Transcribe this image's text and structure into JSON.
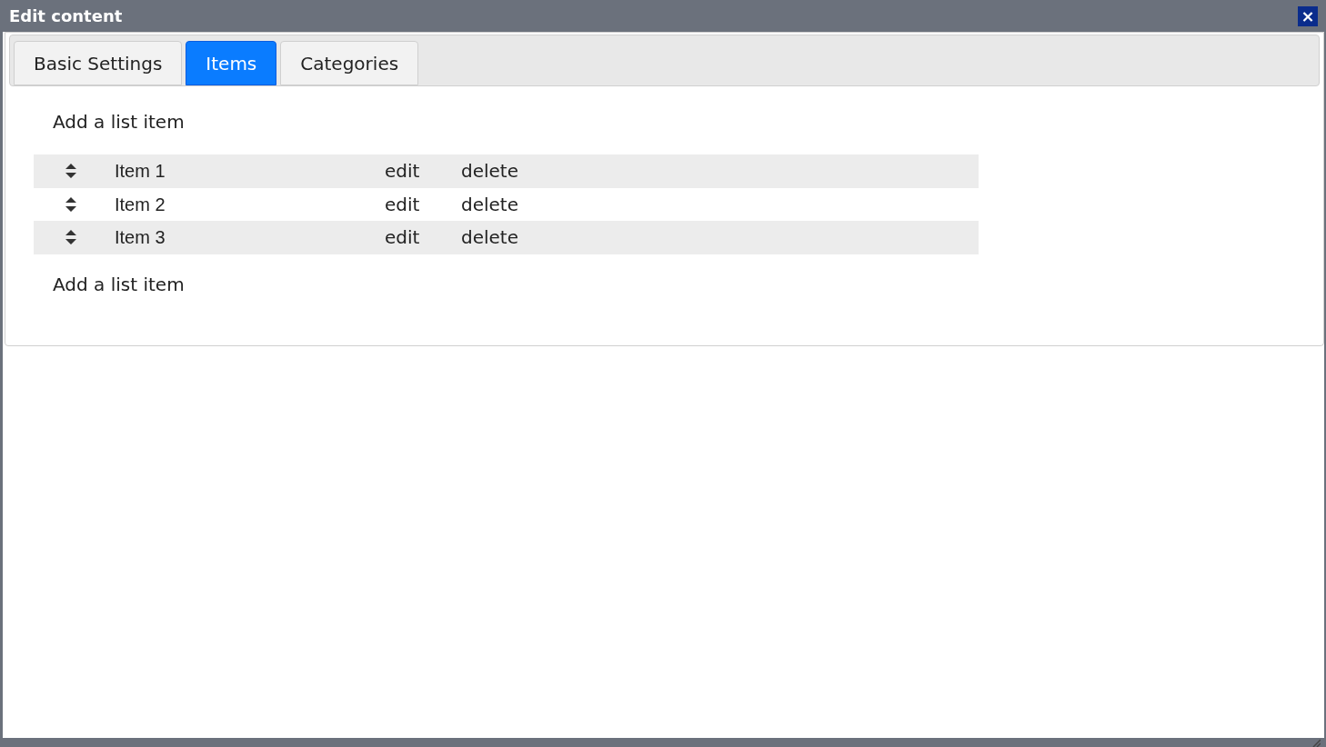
{
  "window": {
    "title": "Edit content",
    "close_label": "×"
  },
  "tabs": [
    {
      "label": "Basic Settings",
      "selected": false
    },
    {
      "label": "Items",
      "selected": true
    },
    {
      "label": "Categories",
      "selected": false
    }
  ],
  "add_link_top": "Add a list item",
  "items": [
    {
      "label": "Item 1",
      "edit": "edit",
      "delete": "delete"
    },
    {
      "label": "Item 2",
      "edit": "edit",
      "delete": "delete"
    },
    {
      "label": "Item 3",
      "edit": "edit",
      "delete": "delete"
    }
  ],
  "add_link_bottom": "Add a list item"
}
